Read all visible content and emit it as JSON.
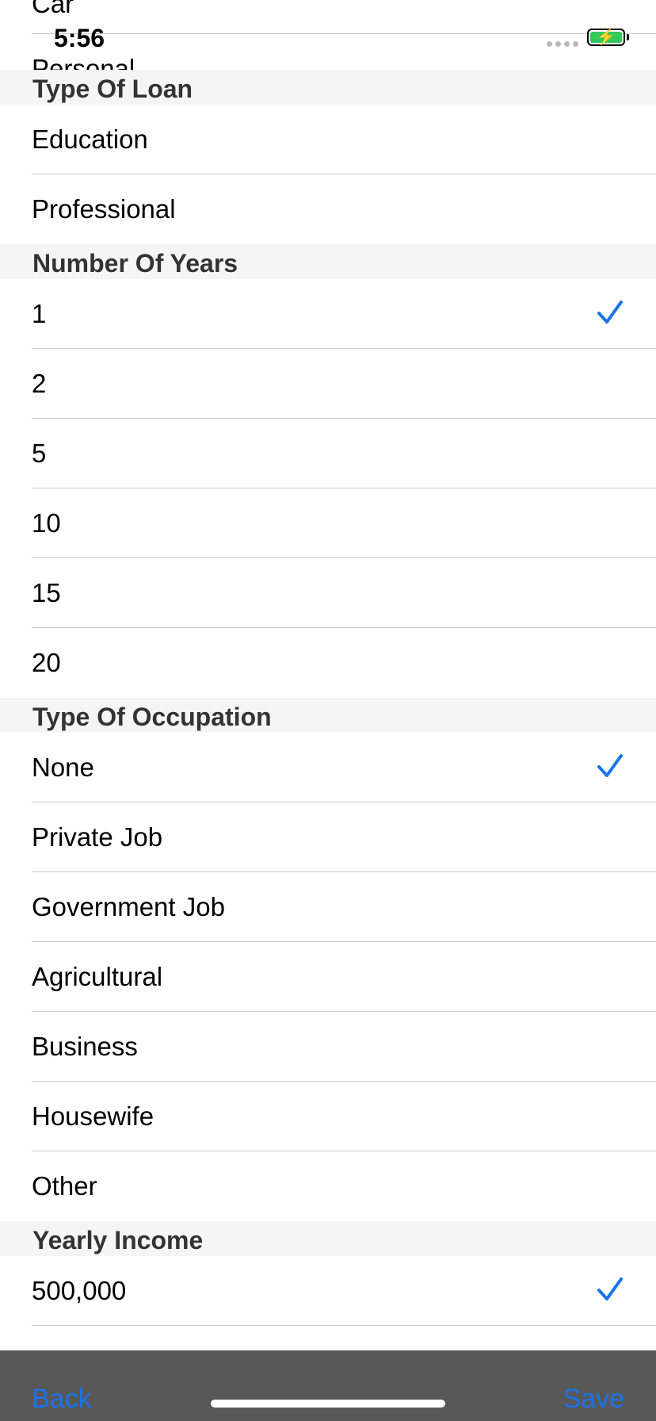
{
  "status_bar": {
    "time": "5:56"
  },
  "scrolled_rows": [
    "Car",
    "Personal"
  ],
  "sections": [
    {
      "header": "Type Of Loan",
      "items": [
        {
          "label": "Education",
          "checked": false
        },
        {
          "label": "Professional",
          "checked": false
        }
      ]
    },
    {
      "header": "Number Of Years",
      "items": [
        {
          "label": "1",
          "checked": true
        },
        {
          "label": "2",
          "checked": false
        },
        {
          "label": "5",
          "checked": false
        },
        {
          "label": "10",
          "checked": false
        },
        {
          "label": "15",
          "checked": false
        },
        {
          "label": "20",
          "checked": false
        }
      ]
    },
    {
      "header": "Type Of Occupation",
      "items": [
        {
          "label": "None",
          "checked": true
        },
        {
          "label": "Private Job",
          "checked": false
        },
        {
          "label": "Government Job",
          "checked": false
        },
        {
          "label": "Agricultural",
          "checked": false
        },
        {
          "label": "Business",
          "checked": false
        },
        {
          "label": "Housewife",
          "checked": false
        },
        {
          "label": "Other",
          "checked": false
        }
      ]
    },
    {
      "header": "Yearly Income",
      "items": [
        {
          "label": "500,000",
          "checked": true
        }
      ]
    }
  ],
  "toolbar": {
    "back_label": "Back",
    "save_label": "Save"
  },
  "colors": {
    "accent": "#1a73e8",
    "section_bg": "#f5f5f5",
    "toolbar_bg": "#585858",
    "battery": "#34c759"
  }
}
